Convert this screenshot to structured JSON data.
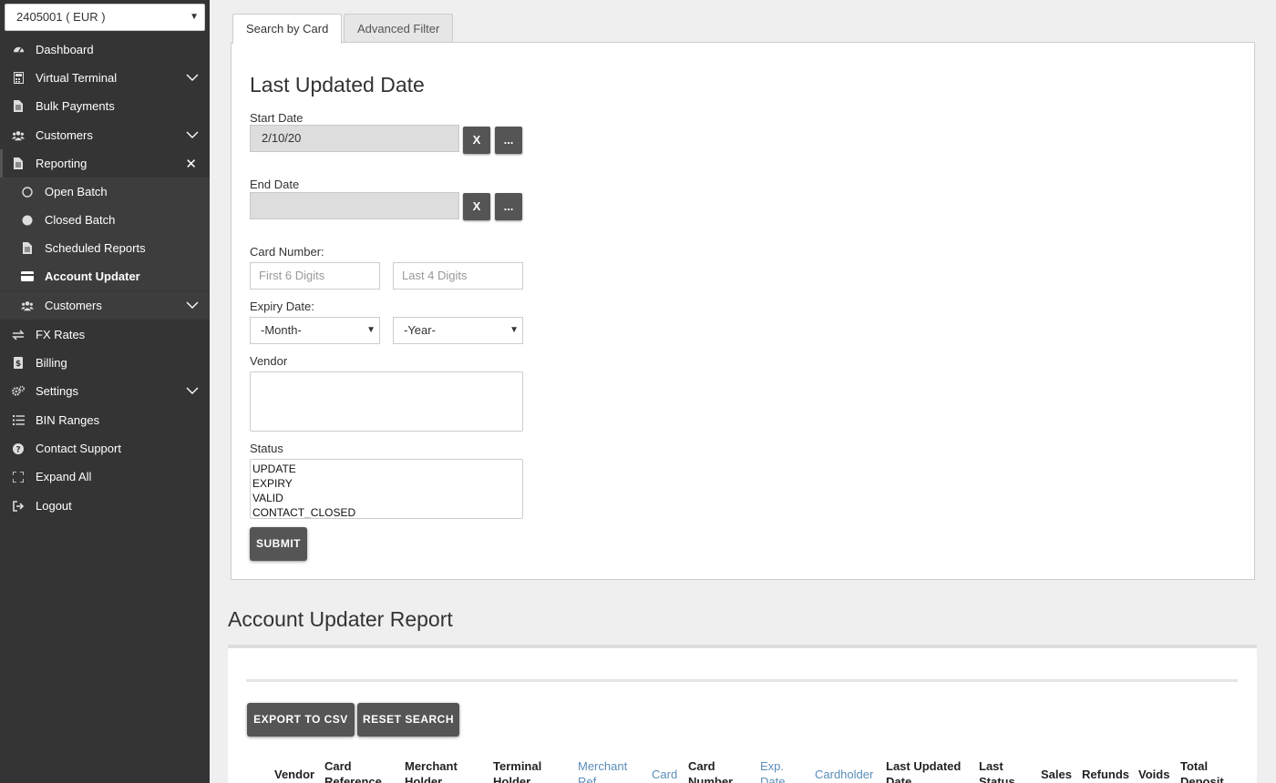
{
  "sidebar": {
    "account": "2405001 ( EUR )",
    "items": [
      {
        "label": "Dashboard"
      },
      {
        "label": "Virtual Terminal"
      },
      {
        "label": "Bulk Payments"
      },
      {
        "label": "Customers"
      },
      {
        "label": "Reporting"
      },
      {
        "label": "Open Batch"
      },
      {
        "label": "Closed Batch"
      },
      {
        "label": "Scheduled Reports"
      },
      {
        "label": "Account Updater"
      },
      {
        "label": "Customers"
      },
      {
        "label": "FX Rates"
      },
      {
        "label": "Billing"
      },
      {
        "label": "Settings"
      },
      {
        "label": "BIN Ranges"
      },
      {
        "label": "Contact Support"
      },
      {
        "label": "Expand All"
      },
      {
        "label": "Logout"
      }
    ]
  },
  "tabs": {
    "card": "Search by Card",
    "advanced": "Advanced Filter"
  },
  "filter": {
    "heading": "Last Updated Date",
    "start_label": "Start Date",
    "start_value": "2/10/20",
    "end_label": "End Date",
    "end_value": "",
    "clear_btn": "X",
    "pick_btn": "...",
    "card_label": "Card Number:",
    "first6_ph": "First 6 Digits",
    "last4_ph": "Last 4 Digits",
    "expiry_label": "Expiry Date:",
    "month": "-Month-",
    "year": "-Year-",
    "vendor_label": "Vendor",
    "status_label": "Status",
    "status_options": [
      "UPDATE",
      "EXPIRY",
      "VALID",
      "CONTACT_CLOSED"
    ],
    "submit": "SUBMIT"
  },
  "report": {
    "title": "Account Updater Report",
    "export": "EXPORT TO CSV",
    "reset": "RESET SEARCH",
    "columns": [
      {
        "l1": "Vendor",
        "l2": ""
      },
      {
        "l1": "Card",
        "l2": "Reference"
      },
      {
        "l1": "Merchant",
        "l2": "Holder"
      },
      {
        "l1": "Terminal",
        "l2": "Holder"
      },
      {
        "l1": "Merchant",
        "l2": "Ref"
      },
      {
        "l1": "Card",
        "l2": ""
      },
      {
        "l1": "Card",
        "l2": "Number"
      },
      {
        "l1": "Exp.",
        "l2": "Date"
      },
      {
        "l1": "Cardholder",
        "l2": ""
      },
      {
        "l1": "Last Updated",
        "l2": "Date"
      },
      {
        "l1": "Last",
        "l2": "Status"
      },
      {
        "l1": "Sales",
        "l2": ""
      },
      {
        "l1": "Refunds",
        "l2": ""
      },
      {
        "l1": "Voids",
        "l2": ""
      },
      {
        "l1": "Total",
        "l2": "Deposit"
      }
    ]
  },
  "colors": {
    "sidebar": "#343434",
    "button": "#555555",
    "link": "#5a8dba"
  }
}
